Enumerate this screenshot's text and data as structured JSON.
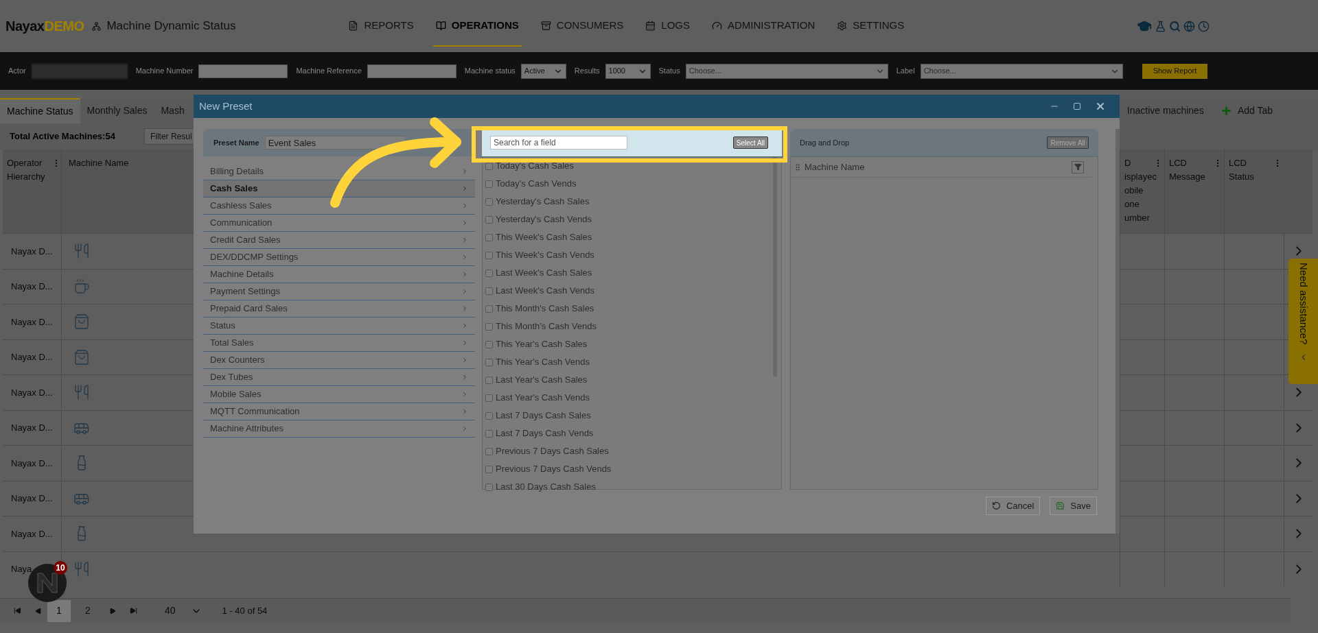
{
  "header": {
    "brand": "Nayax",
    "brand_suffix": "DEMO",
    "page_title": "Machine Dynamic Status",
    "nav": [
      {
        "label": "REPORTS",
        "selected": false
      },
      {
        "label": "OPERATIONS",
        "selected": true
      },
      {
        "label": "CONSUMERS",
        "selected": false
      },
      {
        "label": "LOGS",
        "selected": false
      },
      {
        "label": "ADMINISTRATION",
        "selected": false
      },
      {
        "label": "SETTINGS",
        "selected": false
      }
    ]
  },
  "filters": [
    {
      "label": "Actor",
      "kind": "blurred"
    },
    {
      "label": "Machine Number",
      "kind": "text"
    },
    {
      "label": "Machine Reference",
      "kind": "text"
    },
    {
      "label": "Machine status",
      "kind": "select",
      "value": "Active"
    },
    {
      "label": "Results",
      "kind": "select",
      "value": "1000"
    },
    {
      "label": "Status",
      "kind": "wide",
      "placeholder": "Choose..."
    },
    {
      "label": "Label",
      "kind": "wide",
      "placeholder": "Choose..."
    }
  ],
  "show_report": "Show Report",
  "tabs": [
    {
      "label": "Machine Status",
      "selected": true
    },
    {
      "label": "Monthly Sales",
      "selected": false
    },
    {
      "label": "Mash",
      "selected": false
    }
  ],
  "tabs_right": [
    {
      "label": "Inactive machines",
      "selected": false
    }
  ],
  "add_tab": "Add Tab",
  "total": "Total Active Machines:54",
  "filter_placeholder": "Filter Resul",
  "table": {
    "columns_left": [
      "Operator Hierarchy",
      "Machine Name"
    ],
    "columns_right": [
      {
        "lines": [
          "D",
          "isplayec",
          "obile",
          "one",
          "umber"
        ]
      },
      {
        "lines": [
          "LCD",
          "Message"
        ]
      },
      {
        "lines": [
          "LCD",
          "Status"
        ]
      }
    ],
    "rows": [
      {
        "operator": "Nayax D...",
        "kind": "utensils"
      },
      {
        "operator": "Nayax D...",
        "kind": "cup"
      },
      {
        "operator": "Nayax D...",
        "kind": "bag"
      },
      {
        "operator": "Nayax D...",
        "kind": "bag"
      },
      {
        "operator": "Nayax D...",
        "kind": "utensils"
      },
      {
        "operator": "Nayax D...",
        "kind": "bus"
      },
      {
        "operator": "Nayax D...",
        "kind": "bottle"
      },
      {
        "operator": "Nayax D...",
        "kind": "bus"
      },
      {
        "operator": "Nayax D...",
        "kind": "bottle"
      },
      {
        "operator": "Naya",
        "kind": "utensils"
      }
    ]
  },
  "pagination": {
    "pages": [
      {
        "label": "1",
        "selected": true
      },
      {
        "label": "2",
        "selected": false
      }
    ],
    "page_size": "40",
    "summary": "1 - 40 of 54"
  },
  "notification_count": "10",
  "assistance": "Need assistance?",
  "modal": {
    "title": "New Preset",
    "preset_label": "Preset Name",
    "preset_value": "Event Sales",
    "categories": [
      {
        "label": "Billing Details",
        "selected": false
      },
      {
        "label": "Cash Sales",
        "selected": true
      },
      {
        "label": "Cashless Sales",
        "selected": false
      },
      {
        "label": "Communication",
        "selected": false
      },
      {
        "label": "Credit Card Sales",
        "selected": false
      },
      {
        "label": "DEX/DDCMP Settings",
        "selected": false
      },
      {
        "label": "Machine Details",
        "selected": false
      },
      {
        "label": "Payment Settings",
        "selected": false
      },
      {
        "label": "Prepaid Card Sales",
        "selected": false
      },
      {
        "label": "Status",
        "selected": false
      },
      {
        "label": "Total Sales",
        "selected": false
      },
      {
        "label": "Dex Counters",
        "selected": false
      },
      {
        "label": "Dex Tubes",
        "selected": false
      },
      {
        "label": "Mobile Sales",
        "selected": false
      },
      {
        "label": "MQTT Communication",
        "selected": false
      },
      {
        "label": "Machine Attributes",
        "selected": false
      }
    ],
    "search_placeholder": "Search for a field",
    "select_all": "Select All",
    "fields": [
      {
        "label": "Today's Cash Sales",
        "checked": false
      },
      {
        "label": "Today's Cash Vends",
        "checked": false
      },
      {
        "label": "Yesterday's Cash Sales",
        "checked": false
      },
      {
        "label": "Yesterday's Cash Vends",
        "checked": false
      },
      {
        "label": "This Week's Cash Sales",
        "checked": false
      },
      {
        "label": "This Week's Cash Vends",
        "checked": false
      },
      {
        "label": "Last Week's Cash Sales",
        "checked": false
      },
      {
        "label": "Last Week's Cash Vends",
        "checked": false
      },
      {
        "label": "This Month's Cash Sales",
        "checked": false
      },
      {
        "label": "This Month's Cash Vends",
        "checked": false
      },
      {
        "label": "This Year's Cash Sales",
        "checked": false
      },
      {
        "label": "This Year's Cash Vends",
        "checked": false
      },
      {
        "label": "Last Year's Cash Sales",
        "checked": false
      },
      {
        "label": "Last Year's Cash Vends",
        "checked": false
      },
      {
        "label": "Last 7 Days Cash Sales",
        "checked": false
      },
      {
        "label": "Last 7 Days Cash Vends",
        "checked": false
      },
      {
        "label": "Previous 7 Days Cash Sales",
        "checked": false
      },
      {
        "label": "Previous 7 Days Cash Vends",
        "checked": false
      },
      {
        "label": "Last 30 Days Cash Sales",
        "checked": false
      }
    ],
    "drop_title": "Drag and Drop",
    "remove_all": "Remove All",
    "selected_columns": [
      "Machine Name"
    ],
    "cancel": "Cancel",
    "save": "Save"
  }
}
